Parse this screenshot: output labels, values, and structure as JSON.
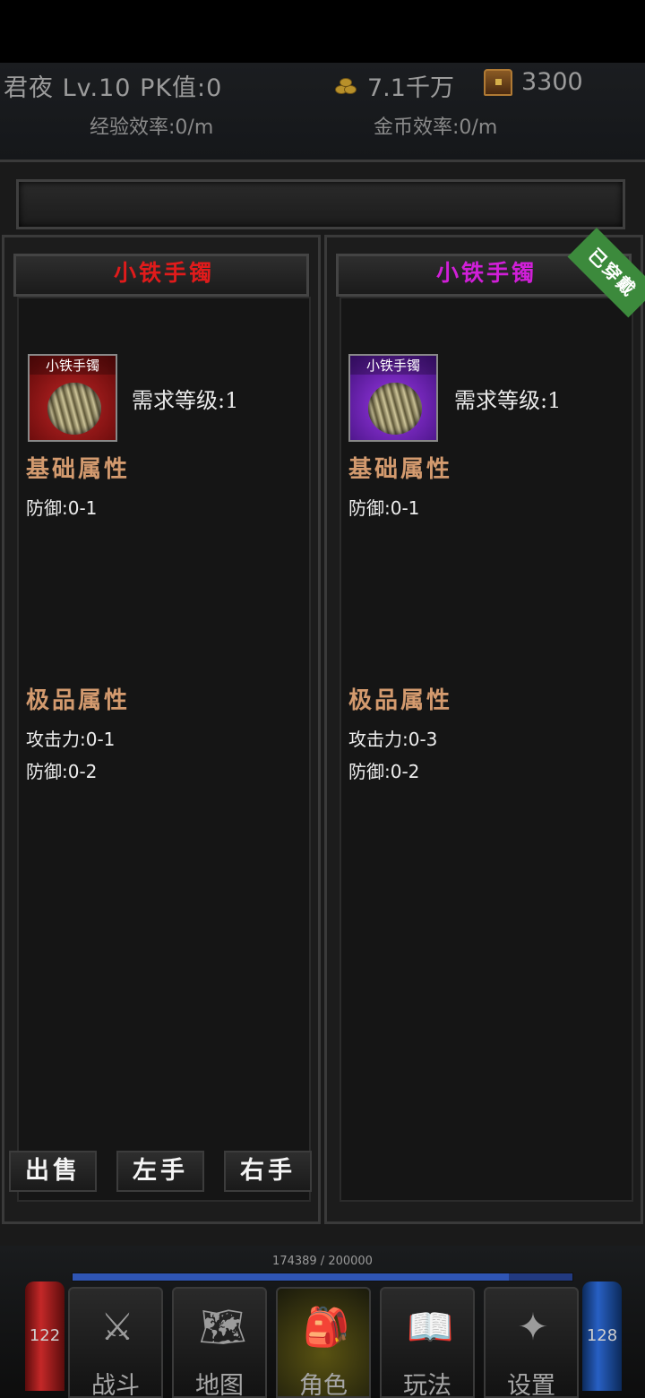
{
  "player": {
    "name": "君夜",
    "level": "Lv.10",
    "pk": "PK值:0",
    "gold": "7.1千万",
    "ingot": "3300",
    "exp_rate": "经验效率:0/m",
    "gold_rate": "金币效率:0/m"
  },
  "left_item": {
    "title": "小铁手镯",
    "icon_label": "小铁手镯",
    "requirement": "需求等级:1",
    "base_title": "基础属性",
    "base_attrs": [
      "防御:0-1"
    ],
    "extra_title": "极品属性",
    "extra_attrs": [
      "攻击力:0-1",
      "防御:0-2"
    ],
    "rarity_color": "#e01b1b"
  },
  "right_item": {
    "title": "小铁手镯",
    "icon_label": "小铁手镯",
    "requirement": "需求等级:1",
    "base_title": "基础属性",
    "base_attrs": [
      "防御:0-1"
    ],
    "extra_title": "极品属性",
    "extra_attrs": [
      "攻击力:0-3",
      "防御:0-2"
    ],
    "badge": "已穿戴",
    "rarity_color": "#d01fd8"
  },
  "actions": {
    "sell": "出售",
    "left_hand": "左手",
    "right_hand": "右手"
  },
  "status": {
    "exp_text": "174389 / 200000",
    "exp_fraction": 0.872,
    "hp": "122",
    "mp": "128"
  },
  "nav": [
    {
      "label": "战斗",
      "icon": "battle-icon"
    },
    {
      "label": "地图",
      "icon": "map-icon"
    },
    {
      "label": "角色",
      "icon": "character-icon"
    },
    {
      "label": "玩法",
      "icon": "gameplay-icon"
    },
    {
      "label": "设置",
      "icon": "settings-icon"
    }
  ],
  "active_nav": "角色"
}
